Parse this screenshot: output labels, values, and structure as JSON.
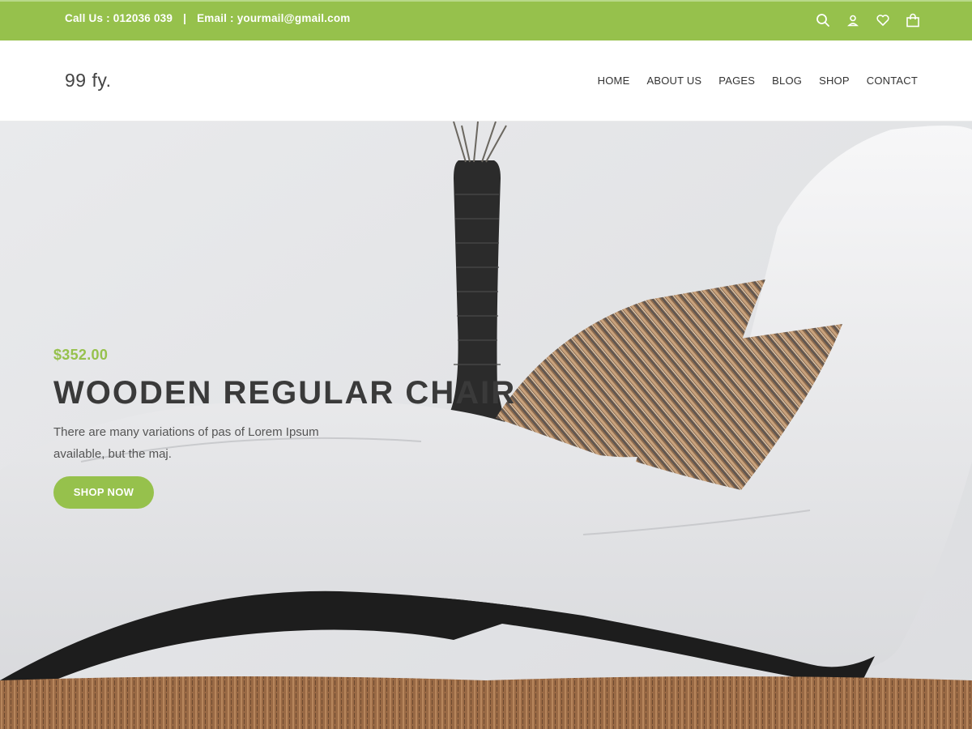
{
  "topbar": {
    "call": "Call Us : 012036 039",
    "separator": "|",
    "email": "Email : yourmail@gmail.com",
    "icons": [
      "search-icon",
      "user-icon",
      "heart-icon",
      "shopping-bag-icon"
    ]
  },
  "header": {
    "logo": "99 fy.",
    "nav": [
      "HOME",
      "ABOUT US",
      "PAGES",
      "BLOG",
      "SHOP",
      "CONTACT"
    ]
  },
  "hero": {
    "price": "$352.00",
    "title": "WOODEN REGULAR CHAIR",
    "description": "There are many variations of pas of Lorem Ipsum available, but the maj.",
    "button": "SHOP NOW"
  },
  "colors": {
    "accent": "#96c14c",
    "heading": "#3a3a3a",
    "text": "#555555"
  }
}
